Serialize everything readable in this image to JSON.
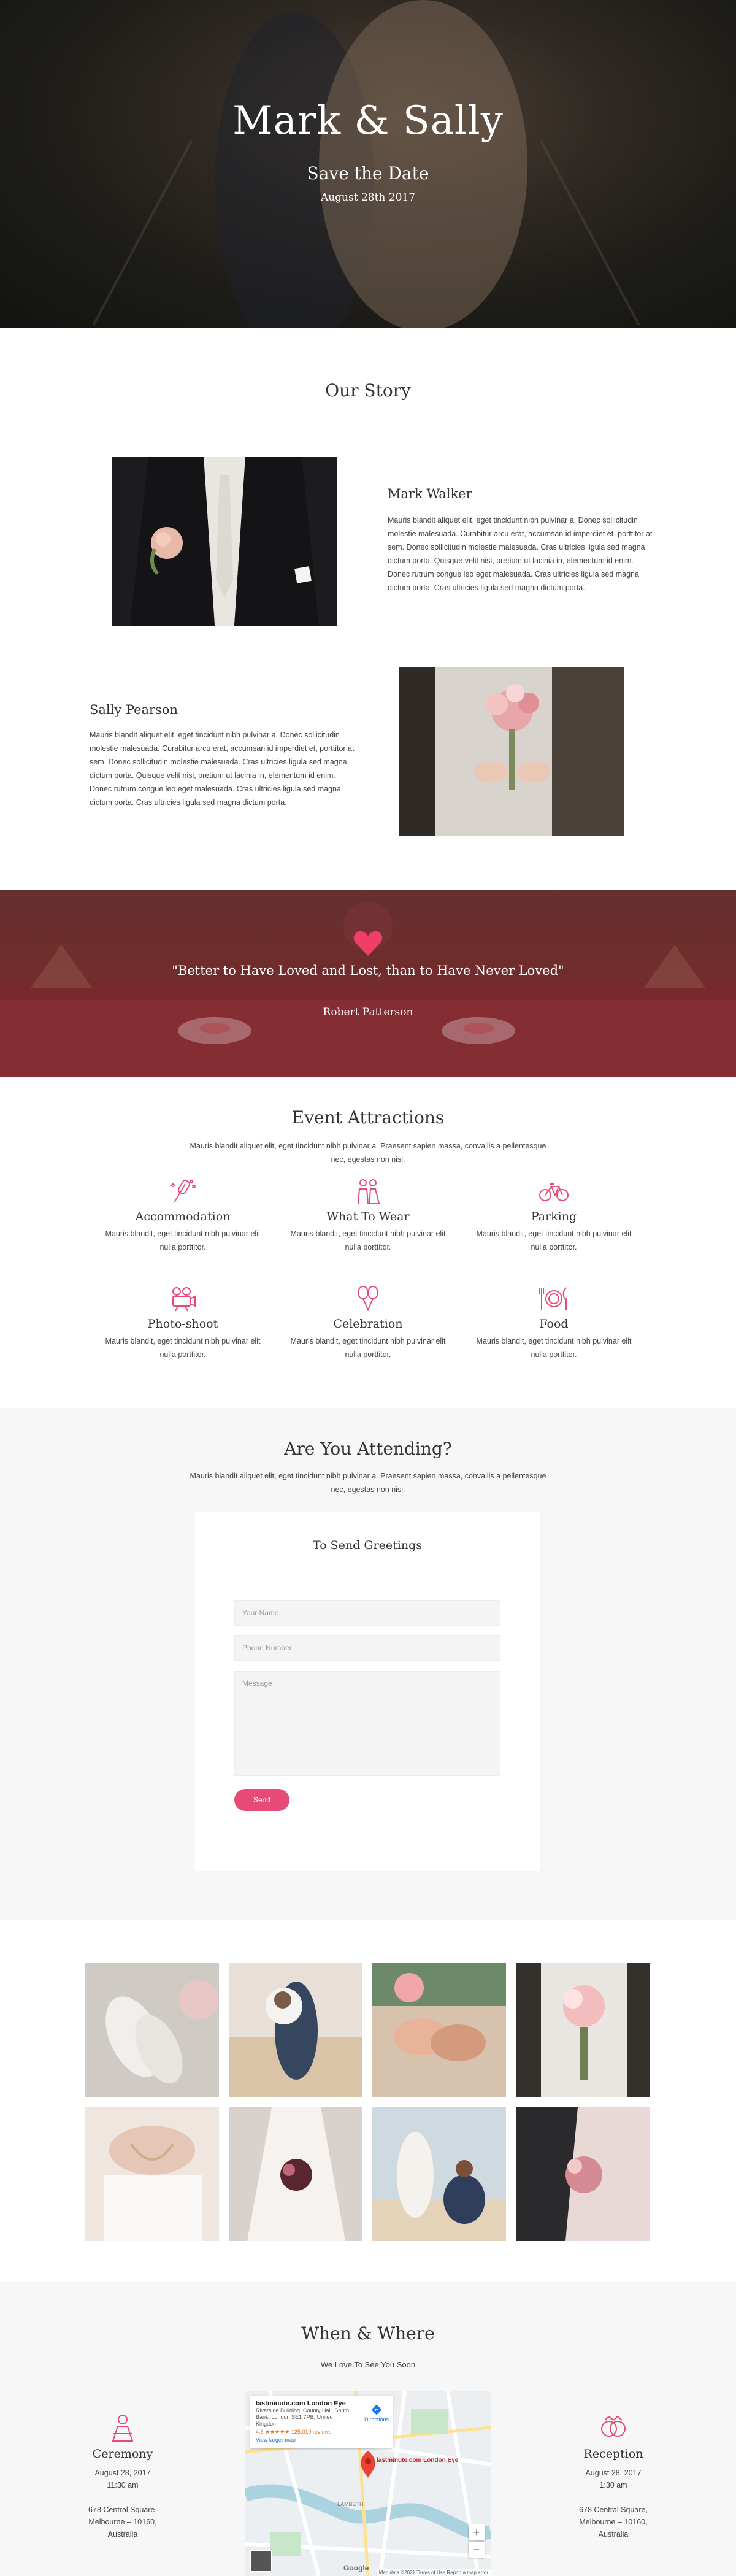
{
  "hero": {
    "title": "Mark & Sally",
    "subtitle": "Save the Date",
    "date": "August 28th 2017"
  },
  "story": {
    "heading": "Our Story",
    "people": [
      {
        "name": "Mark Walker",
        "bio": "Mauris blandit aliquet elit, eget tincidunt nibh pulvinar a. Donec sollicitudin molestie malesuada. Curabitur arcu erat, accumsan id imperdiet et, porttitor at sem. Donec sollicitudin molestie malesuada. Cras ultricies ligula sed magna dictum porta. Quisque velit nisi, pretium ut lacinia in, elementum id enim. Donec rutrum congue leo eget malesuada. Cras ultricies ligula sed magna dictum porta. Cras ultricies ligula sed magna dictum porta."
      },
      {
        "name": "Sally Pearson",
        "bio": "Mauris blandit aliquet elit, eget tincidunt nibh pulvinar a. Donec sollicitudin molestie malesuada. Curabitur arcu erat, accumsan id imperdiet et, porttitor at sem. Donec sollicitudin molestie malesuada. Cras ultricies ligula sed magna dictum porta. Quisque velit nisi, pretium ut lacinia in, elementum id enim. Donec rutrum congue leo eget malesuada. Cras ultricies ligula sed magna dictum porta. Cras ultricies ligula sed magna dictum porta."
      }
    ]
  },
  "quote": {
    "text": "\"Better to Have Loved and Lost, than to Have Never Loved\"",
    "author": "Robert Patterson",
    "icon": "heart-icon"
  },
  "attractions": {
    "heading": "Event Attractions",
    "intro": "Mauris blandit aliquet elit, eget tincidunt nibh pulvinar a. Praesent sapien massa, convallis a pellentesque nec, egestas non nisi.",
    "items": [
      {
        "title": "Accommodation",
        "desc": "Mauris blandit, eget tincidunt nibh pulvinar elit nulla porttitor.",
        "icon": "champagne-icon"
      },
      {
        "title": "What To Wear",
        "desc": "Mauris blandit, eget tincidunt nibh pulvinar elit nulla porttitor.",
        "icon": "couple-icon"
      },
      {
        "title": "Parking",
        "desc": "Mauris blandit, eget tincidunt nibh pulvinar elit nulla porttitor.",
        "icon": "bicycle-icon"
      },
      {
        "title": "Photo-shoot",
        "desc": "Mauris blandit, eget tincidunt nibh pulvinar elit nulla porttitor.",
        "icon": "camera-icon"
      },
      {
        "title": "Celebration",
        "desc": "Mauris blandit, eget tincidunt nibh pulvinar elit nulla porttitor.",
        "icon": "balloons-icon"
      },
      {
        "title": "Food",
        "desc": "Mauris blandit, eget tincidunt nibh pulvinar elit nulla porttitor.",
        "icon": "plate-icon"
      }
    ]
  },
  "rsvp": {
    "heading": "Are You Attending?",
    "intro": "Mauris blandit aliquet elit, eget tincidunt nibh pulvinar a. Praesent sapien massa, convallis a pellentesque nec, egestas non nisi.",
    "form_title": "To Send Greetings",
    "name_placeholder": "Your Name",
    "phone_placeholder": "Phone Number",
    "message_placeholder": "Message",
    "send_label": "Send"
  },
  "where": {
    "heading": "When & Where",
    "tagline": "We Love To See You Soon",
    "ceremony": {
      "title": "Ceremony",
      "date": "August 28, 2017",
      "time": "11:30 am",
      "address1": "678 Central Square,",
      "address2": "Melbourne – 10160,",
      "address3": "Australia",
      "icon": "bride-icon"
    },
    "reception": {
      "title": "Reception",
      "date": "August 28, 2017",
      "time": "1:30 am",
      "address1": "678 Central Square,",
      "address2": "Melbourne – 10160,",
      "address3": "Australia",
      "icon": "rings-icon"
    },
    "map": {
      "place_title": "lastminute.com London Eye",
      "place_address1": "Riverside Building, County Hall, South",
      "place_address2": "Bank, London SE1 7PB, United",
      "place_address3": "Kingdom",
      "rating": "4.5 ★★★★★ 125,019 reviews",
      "larger_map": "View larger map",
      "directions": "Directions",
      "pin_label": "lastminute.com London Eye",
      "district": "LAMBETH",
      "brand": "Google",
      "footer": "Map data ©2021   Terms of Use   Report a map error",
      "zoom_in": "+",
      "zoom_out": "−"
    }
  },
  "colors": {
    "accent": "#e84a77",
    "icon": "#e84a77"
  }
}
